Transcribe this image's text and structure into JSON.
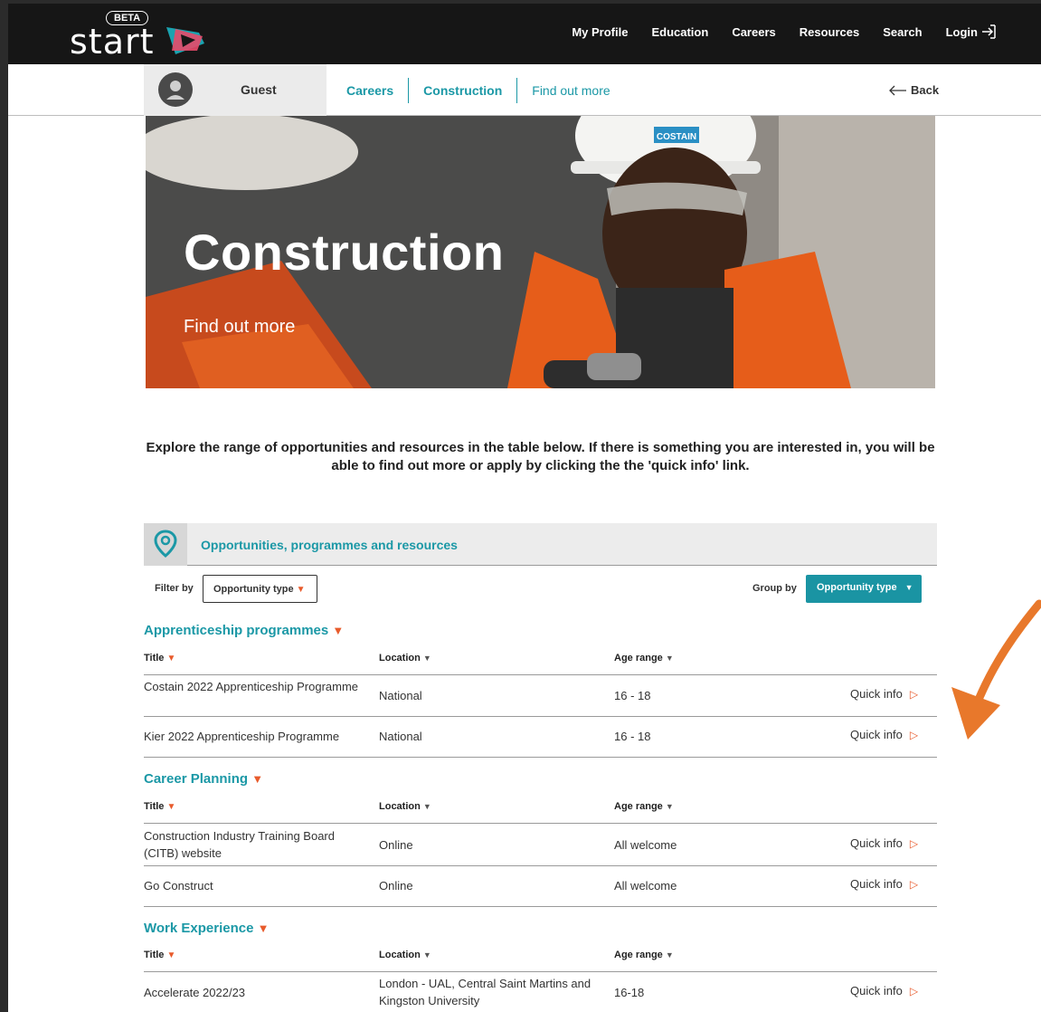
{
  "header": {
    "logo_text": "start",
    "beta_badge": "BETA",
    "nav": [
      "My Profile",
      "Education",
      "Careers",
      "Resources",
      "Search"
    ],
    "login": "Login"
  },
  "breadcrumb": {
    "user": "Guest",
    "items": [
      "Careers",
      "Construction",
      "Find out more"
    ],
    "back": "Back"
  },
  "hero": {
    "title": "Construction",
    "subtitle": "Find out more",
    "helmet_label": "COSTAIN"
  },
  "intro": "Explore the range of opportunities and resources in the table below.  If there is something you are interested in, you will be able to find out more or apply by clicking the the 'quick info' link.",
  "panel": {
    "title": "Opportunities, programmes and resources",
    "filter_label": "Filter by",
    "filter_value": "Opportunity type",
    "group_label": "Group by",
    "group_value": "Opportunity type"
  },
  "columns": {
    "title": "Title",
    "location": "Location",
    "age": "Age range"
  },
  "quick_info": "Quick info",
  "sections": [
    {
      "name": "Apprenticeship programmes",
      "rows": [
        {
          "title": "Costain 2022 Apprenticeship Programme",
          "location": "National",
          "age": "16 - 18"
        },
        {
          "title": "Kier 2022 Apprenticeship Programme",
          "location": "National",
          "age": "16 - 18"
        }
      ]
    },
    {
      "name": "Career Planning",
      "rows": [
        {
          "title": "Construction Industry Training Board (CITB) website",
          "location": "Online",
          "age": "All welcome"
        },
        {
          "title": "Go Construct",
          "location": "Online",
          "age": "All welcome"
        }
      ]
    },
    {
      "name": "Work Experience",
      "rows": [
        {
          "title": "Accelerate 2022/23",
          "location": "London - UAL, Central Saint Martins and Kingston University",
          "age": "16-18"
        }
      ]
    }
  ],
  "colors": {
    "teal": "#1b98a6",
    "orange": "#e85b2c",
    "nav_bg": "#161616",
    "arrow": "#e8782b"
  }
}
